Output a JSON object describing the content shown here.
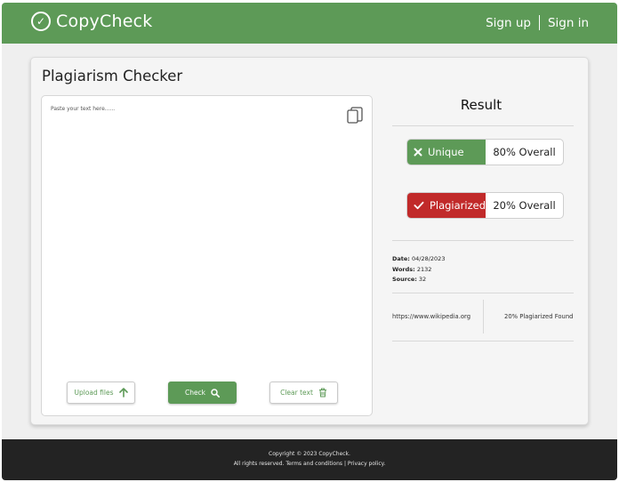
{
  "header": {
    "brand": "CopyCheck",
    "signup_label": "Sign up",
    "signin_label": "Sign in",
    "color": "#5d9a57"
  },
  "checker": {
    "title": "Plagiarism Checker",
    "placeholder": "Paste your text here......",
    "buttons": {
      "upload": "Upload files",
      "check": "Check",
      "clear": "Clear text"
    }
  },
  "result": {
    "title": "Result",
    "unique_label": "Unique",
    "unique_value": "80% Overall",
    "plagiarized_label": "Plagiarized",
    "plagiarized_value": "20% Overall",
    "unique_color": "#5d9a57",
    "plagiarized_color": "#c12a2a",
    "date_label": "Date:",
    "date_value": "04/28/2023",
    "words_label": "Words:",
    "words_value": "2132",
    "source_label": "Source:",
    "source_value": "32",
    "source_url": "https://www.wikipedia.org",
    "source_found": "20% Plagiarized Found"
  },
  "footer": {
    "copyright": "Copyright © 2023 CopyCheck.",
    "rights": "All rights reserved.",
    "terms": "Terms and conditions",
    "separator": "|",
    "privacy": "Privacy policy."
  },
  "icons": [
    "check-circle-icon",
    "copy-icon",
    "arrow-up-icon",
    "search-icon",
    "trash-icon",
    "x-icon",
    "checkmark-icon"
  ]
}
